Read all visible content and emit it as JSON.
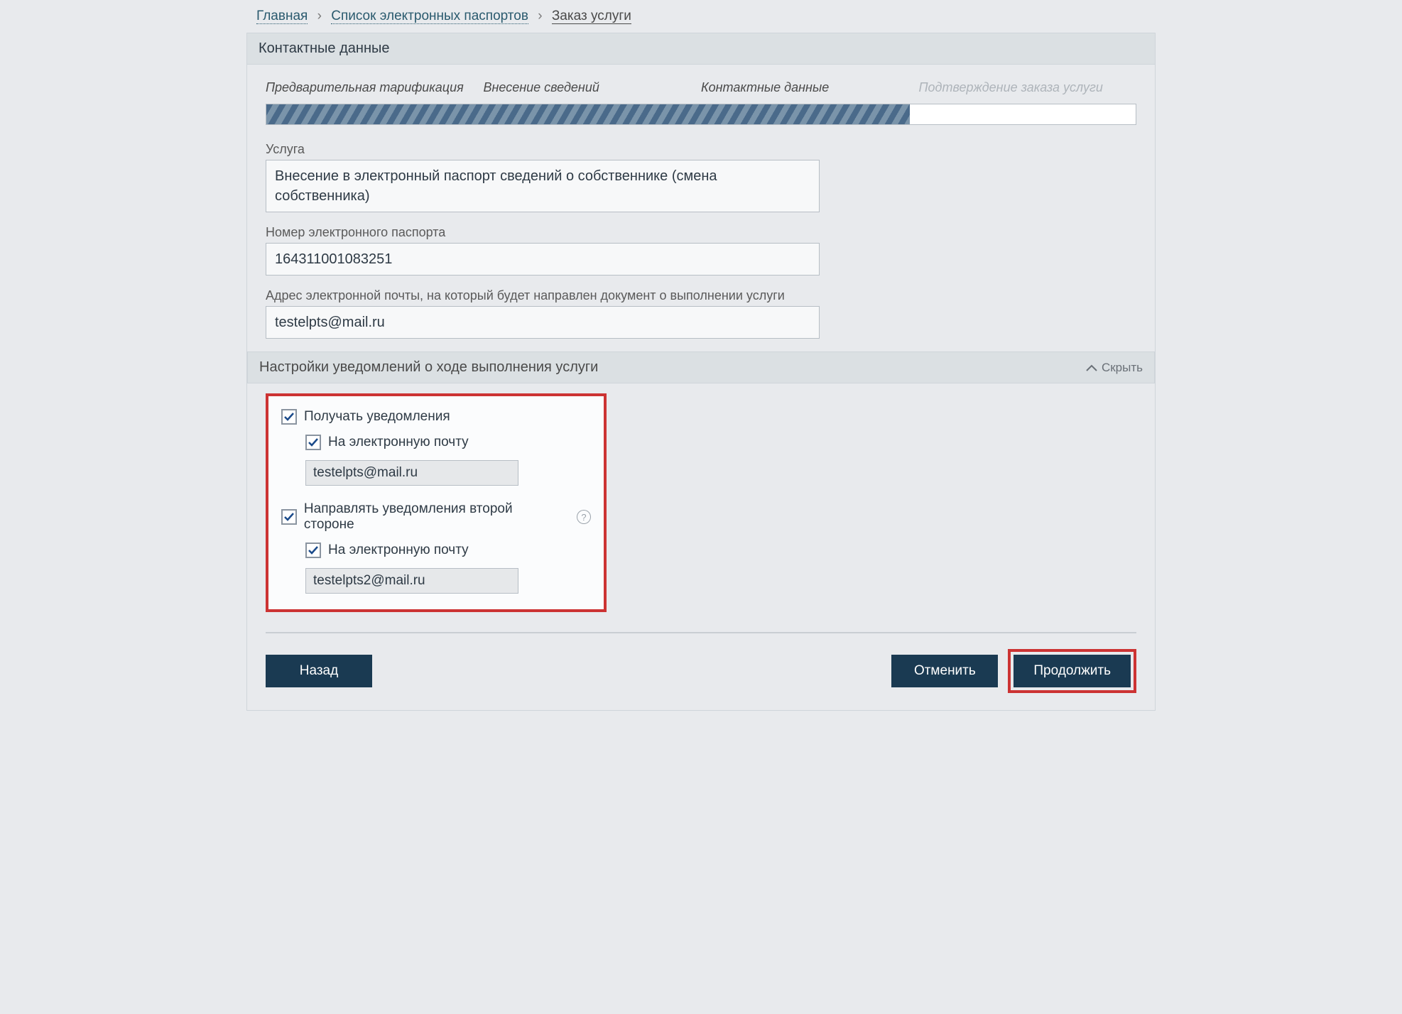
{
  "breadcrumb": {
    "home": "Главная",
    "list": "Список электронных паспортов",
    "current": "Заказ услуги"
  },
  "section_title": "Контактные данные",
  "steps": {
    "s1": "Предварительная тарификация",
    "s2": "Внесение сведений",
    "s3": "Контактные данные",
    "s4": "Подтверждение заказа услуги"
  },
  "service": {
    "label": "Услуга",
    "value": "Внесение в электронный паспорт сведений о собственнике (смена собственника)"
  },
  "passport": {
    "label": "Номер электронного паспорта",
    "value": "164311001083251"
  },
  "email": {
    "label": "Адрес электронной почты, на который будет направлен документ о выполнении услуги",
    "value": "testelpts@mail.ru"
  },
  "accordion": {
    "title": "Настройки уведомлений о ходе выполнения услуги",
    "toggle": "Скрыть"
  },
  "notify": {
    "receive": "Получать уведомления",
    "by_email": "На электронную почту",
    "email1": "testelpts@mail.ru",
    "second_party": "Направлять уведомления второй стороне",
    "email2": "testelpts2@mail.ru"
  },
  "buttons": {
    "back": "Назад",
    "cancel": "Отменить",
    "next": "Продолжить"
  }
}
